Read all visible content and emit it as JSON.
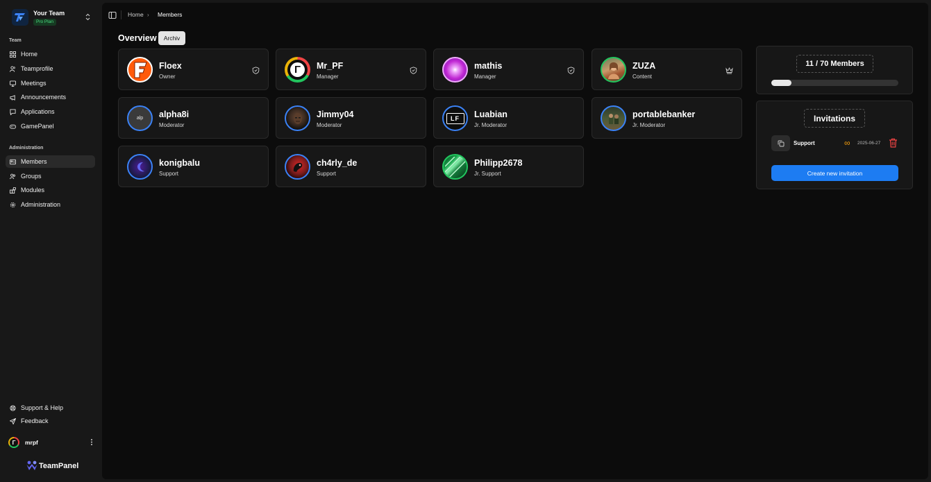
{
  "team": {
    "name": "Your Team",
    "plan": "Pro Plan"
  },
  "sidebar": {
    "team_section": "Team",
    "team_items": [
      {
        "label": "Home",
        "icon": "grid-icon"
      },
      {
        "label": "Teamprofile",
        "icon": "users-icon"
      },
      {
        "label": "Meetings",
        "icon": "monitor-icon"
      },
      {
        "label": "Announcements",
        "icon": "megaphone-icon"
      },
      {
        "label": "Applications",
        "icon": "chat-icon"
      },
      {
        "label": "GamePanel",
        "icon": "gamepad-icon"
      }
    ],
    "admin_section": "Administration",
    "admin_items": [
      {
        "label": "Members",
        "icon": "id-card-icon",
        "active": true
      },
      {
        "label": "Groups",
        "icon": "users-group-icon"
      },
      {
        "label": "Modules",
        "icon": "modules-icon"
      },
      {
        "label": "Administration",
        "icon": "settings-icon"
      }
    ],
    "support_label": "Support & Help",
    "feedback_label": "Feedback",
    "user": {
      "name": "mrpf",
      "initial": "Γ"
    },
    "brand": "TeamPanel"
  },
  "breadcrumb": {
    "home": "Home",
    "current": "Members"
  },
  "overview": {
    "title": "Overview",
    "archiv_label": "Archiv"
  },
  "members": [
    {
      "name": "Floex",
      "role": "Owner",
      "badge": "shield-icon",
      "avatar_text": "F"
    },
    {
      "name": "Mr_PF",
      "role": "Manager",
      "badge": "shield-icon",
      "avatar_text": "Γ"
    },
    {
      "name": "mathis",
      "role": "Manager",
      "badge": "shield-icon",
      "avatar_text": ""
    },
    {
      "name": "ZUZA",
      "role": "Content",
      "badge": "crown-icon",
      "avatar_text": ""
    },
    {
      "name": "alpha8i",
      "role": "Moderator",
      "avatar_text": "alp"
    },
    {
      "name": "Jimmy04",
      "role": "Moderator",
      "avatar_text": ""
    },
    {
      "name": "Luabian",
      "role": "Jr. Moderator",
      "avatar_text": "LF"
    },
    {
      "name": "portablebanker",
      "role": "Jr. Moderator",
      "avatar_text": ""
    },
    {
      "name": "konigbalu",
      "role": "Support",
      "avatar_text": ""
    },
    {
      "name": "ch4rly_de",
      "role": "Support",
      "avatar_text": ""
    },
    {
      "name": "Philipp2678",
      "role": "Jr. Support",
      "avatar_text": ""
    }
  ],
  "member_count": {
    "label": "11 / 70 Members",
    "current": 11,
    "max": 70,
    "fraction": 0.157
  },
  "invitations": {
    "title": "Invitations",
    "items": [
      {
        "group": "Support",
        "uses_symbol": "∞",
        "date": "2025-06-27"
      }
    ],
    "create_label": "Create new invitation"
  },
  "colors": {
    "accent": "#1d7cf2",
    "ring": "#3b82f6",
    "danger": "#ef4444",
    "infinity": "#f59e0b",
    "plan": "#4ade80"
  }
}
